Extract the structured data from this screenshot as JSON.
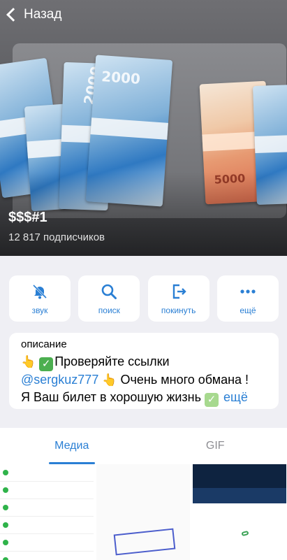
{
  "nav": {
    "back_label": "Назад"
  },
  "channel": {
    "title": "$$$#1",
    "subscribers": "12 817 подписчиков"
  },
  "actions": [
    {
      "label": "звук",
      "icon": "bell-muted-icon"
    },
    {
      "label": "поиск",
      "icon": "search-icon"
    },
    {
      "label": "покинуть",
      "icon": "leave-icon"
    },
    {
      "label": "ещё",
      "icon": "more-icon"
    }
  ],
  "description": {
    "heading": "описание",
    "line1": "Проверяйте ссылки",
    "handle": "@sergkuz777",
    "line2_text": "Очень много обмана !",
    "line3_text": "Я Ваш билет в хорошую жизнь",
    "more_label": "ещё"
  },
  "tabs": [
    {
      "label": "Медиа",
      "active": true
    },
    {
      "label": "GIF",
      "active": false
    }
  ],
  "colors": {
    "accent": "#2a7fd4",
    "background": "#efeff4"
  }
}
